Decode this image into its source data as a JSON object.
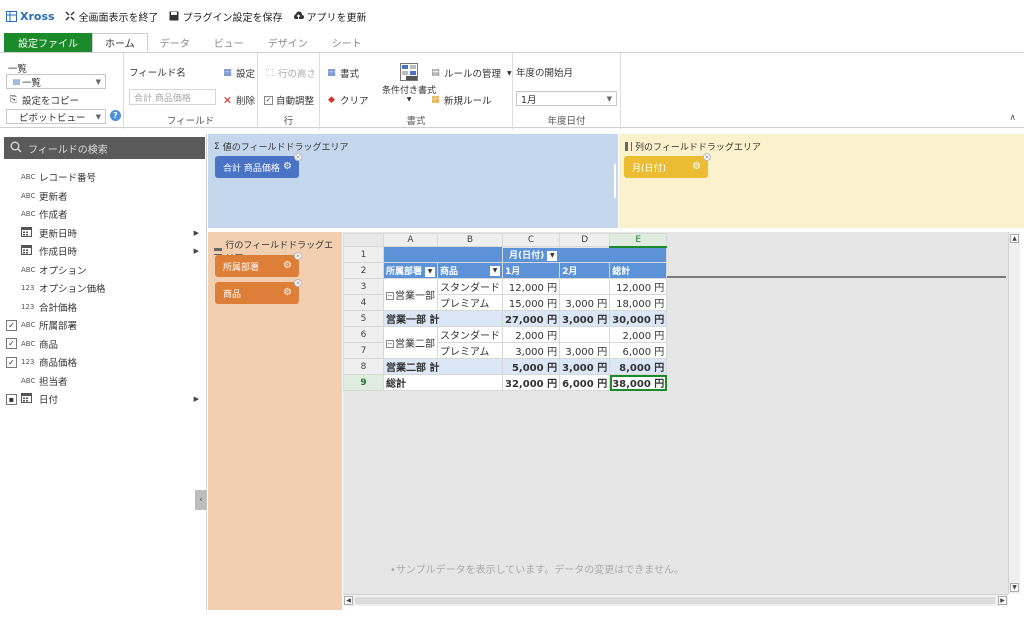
{
  "titlebar": {
    "brand": "Xross",
    "exit_fullscreen": "全画面表示を終了",
    "save_plugin": "プラグイン設定を保存",
    "update_app": "アプリを更新"
  },
  "tabs": [
    "設定ファイル",
    "ホーム",
    "データ",
    "ビュー",
    "デザイン",
    "シート"
  ],
  "ribbon": {
    "view_group": {
      "list_label": "一覧",
      "list_select": "一覧",
      "copy_settings": "設定をコピー",
      "view_type": "ピボットビュー"
    },
    "field_group": {
      "field_name_label": "フィールド名",
      "field_name_value": "合計 商品価格",
      "settings": "設定",
      "delete": "削除",
      "label": "フィールド"
    },
    "row_group": {
      "row_height": "行の高さ",
      "auto_adjust": "自動調整",
      "label": "行"
    },
    "format_group": {
      "format": "書式",
      "clear": "クリア",
      "conditional": "条件付き書式",
      "manage_rules": "ルールの管理",
      "new_rule": "新規ルール",
      "label": "書式"
    },
    "date_group": {
      "fiscal_start_label": "年度の開始月",
      "fiscal_start_value": "1月",
      "label": "年度日付"
    }
  },
  "field_panel": {
    "search_placeholder": "フィールドの検索",
    "fields": [
      {
        "type": "ABC",
        "label": "レコード番号",
        "checked": false,
        "expandable": false
      },
      {
        "type": "ABC",
        "label": "更新者",
        "checked": false,
        "expandable": false
      },
      {
        "type": "ABC",
        "label": "作成者",
        "checked": false,
        "expandable": false
      },
      {
        "type": "calendar",
        "label": "更新日時",
        "checked": false,
        "expandable": true
      },
      {
        "type": "calendar",
        "label": "作成日時",
        "checked": false,
        "expandable": true
      },
      {
        "type": "ABC",
        "label": "オプション",
        "checked": false,
        "expandable": false
      },
      {
        "type": "123",
        "label": "オプション価格",
        "checked": false,
        "expandable": false
      },
      {
        "type": "123",
        "label": "合計価格",
        "checked": false,
        "expandable": false
      },
      {
        "type": "ABC",
        "label": "所属部署",
        "checked": true,
        "expandable": false
      },
      {
        "type": "ABC",
        "label": "商品",
        "checked": true,
        "expandable": false
      },
      {
        "type": "123",
        "label": "商品価格",
        "checked": true,
        "expandable": false
      },
      {
        "type": "ABC",
        "label": "担当者",
        "checked": false,
        "expandable": false
      },
      {
        "type": "calendar",
        "label": "日付",
        "checked": "partial",
        "expandable": true
      }
    ]
  },
  "areas": {
    "values_label": "値のフィールドドラッグエリア",
    "values_chip": "合計 商品価格",
    "columns_label": "列のフィールドドラッグエリア",
    "columns_chip": "月(日付)",
    "rows_label": "行のフィールドドラッグエリア",
    "rows_chips": [
      "所属部署",
      "商品"
    ]
  },
  "grid": {
    "col_headers": [
      "A",
      "B",
      "C",
      "D",
      "E"
    ],
    "row_numbers": [
      "1",
      "2",
      "3",
      "4",
      "5",
      "6",
      "7",
      "8",
      "9"
    ],
    "col_field": "月(日付)",
    "row_field_1": "所属部署",
    "row_field_2": "商品",
    "month_1": "1月",
    "month_2": "2月",
    "grand_total_header": "総計",
    "rows": [
      {
        "dept": "営業一部",
        "product": "スタンダード",
        "m1": "12,000 円",
        "m2": "",
        "total": "12,000 円"
      },
      {
        "dept": "",
        "product": "プレミアム",
        "m1": "15,000 円",
        "m2": "3,000 円",
        "total": "18,000 円"
      },
      {
        "subtotal": "営業一部 計",
        "m1": "27,000 円",
        "m2": "3,000 円",
        "total": "30,000 円"
      },
      {
        "dept": "営業二部",
        "product": "スタンダード",
        "m1": "2,000 円",
        "m2": "",
        "total": "2,000 円"
      },
      {
        "dept": "",
        "product": "プレミアム",
        "m1": "3,000 円",
        "m2": "3,000 円",
        "total": "6,000 円"
      },
      {
        "subtotal": "営業二部 計",
        "m1": "5,000 円",
        "m2": "3,000 円",
        "total": "8,000 円"
      },
      {
        "grandtotal": "総計",
        "m1": "32,000 円",
        "m2": "6,000 円",
        "total": "38,000 円"
      }
    ],
    "notice": "•サンプルデータを表示しています。データの変更はできません。"
  }
}
